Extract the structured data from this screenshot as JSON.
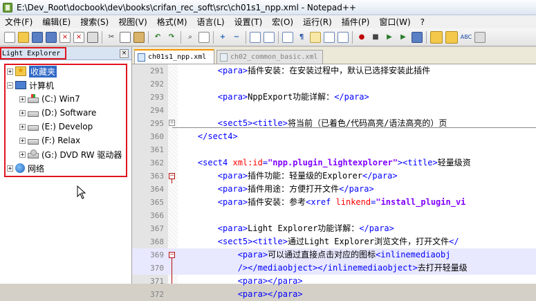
{
  "window": {
    "title": "E:\\Dev_Root\\docbook\\dev\\books\\crifan_rec_soft\\src\\ch01s1_npp.xml - Notepad++"
  },
  "menu": [
    "文件(F)",
    "编辑(E)",
    "搜索(S)",
    "视图(V)",
    "格式(M)",
    "语言(L)",
    "设置(T)",
    "宏(O)",
    "运行(R)",
    "插件(P)",
    "窗口(W)",
    "?"
  ],
  "panel": {
    "title": "Light Explorer",
    "close_label": "×",
    "tree": [
      {
        "label": "收藏夹",
        "expander": "+",
        "icon": "star-folder-icon",
        "selected": true
      },
      {
        "label": "计算机",
        "expander": "−",
        "icon": "computer-icon"
      },
      {
        "label": "(C:) Win7",
        "expander": "+",
        "icon": "system-drive-icon"
      },
      {
        "label": "(D:) Software",
        "expander": "+",
        "icon": "drive-icon"
      },
      {
        "label": "(E:) Develop",
        "expander": "+",
        "icon": "drive-icon"
      },
      {
        "label": "(F:) Relax",
        "expander": "+",
        "icon": "drive-icon"
      },
      {
        "label": "(G:) DVD RW 驱动器",
        "expander": "+",
        "icon": "dvd-drive-icon"
      },
      {
        "label": "网络",
        "expander": "+",
        "icon": "network-icon"
      }
    ]
  },
  "tabs": [
    {
      "label": "ch01s1_npp.xml",
      "active": true
    },
    {
      "label": "ch02_common_basic.xml",
      "active": false
    }
  ],
  "lines": [
    {
      "num": "291",
      "parts": [
        [
          "ind",
          "        "
        ],
        [
          "tag",
          "<para>"
        ],
        [
          "txt",
          "插件安装：在安装过程中，默认已选择安装此插件"
        ]
      ]
    },
    {
      "num": "292",
      "parts": []
    },
    {
      "num": "293",
      "parts": [
        [
          "ind",
          "        "
        ],
        [
          "tag",
          "<para>"
        ],
        [
          "txt",
          "NppExport功能详解："
        ],
        [
          "tag",
          "</para>"
        ]
      ]
    },
    {
      "num": "294",
      "parts": []
    },
    {
      "num": "295",
      "parts": [
        [
          "ind",
          "        "
        ],
        [
          "tag",
          "<sect5><title>"
        ],
        [
          "txt",
          "将当前（已着色/代码高亮/语法高亮的）页"
        ]
      ]
    },
    {
      "num": "360",
      "parts": [
        [
          "ind",
          "    "
        ],
        [
          "tag",
          "</sect4>"
        ]
      ]
    },
    {
      "num": "361",
      "parts": []
    },
    {
      "num": "362",
      "parts": [
        [
          "ind",
          "    "
        ],
        [
          "tag",
          "<sect4 "
        ],
        [
          "attr",
          "xml:id"
        ],
        [
          "tag",
          "="
        ],
        [
          "val",
          "\"npp.plugin_lightexplorer\""
        ],
        [
          "tag",
          "><title>"
        ],
        [
          "txt",
          "轻量级资"
        ]
      ]
    },
    {
      "num": "363",
      "parts": [
        [
          "ind",
          "        "
        ],
        [
          "tag",
          "<para>"
        ],
        [
          "txt",
          "插件功能：轻量级的Explorer"
        ],
        [
          "tag",
          "</para>"
        ]
      ]
    },
    {
      "num": "364",
      "parts": [
        [
          "ind",
          "        "
        ],
        [
          "tag",
          "<para>"
        ],
        [
          "txt",
          "插件用途：方便打开文件"
        ],
        [
          "tag",
          "</para>"
        ]
      ]
    },
    {
      "num": "365",
      "parts": [
        [
          "ind",
          "        "
        ],
        [
          "tag",
          "<para>"
        ],
        [
          "txt",
          "插件安装：参考"
        ],
        [
          "tag",
          "<xref "
        ],
        [
          "attr",
          "linkend"
        ],
        [
          "tag",
          "="
        ],
        [
          "val",
          "\"install_plugin_vi"
        ]
      ]
    },
    {
      "num": "366",
      "parts": []
    },
    {
      "num": "367",
      "parts": [
        [
          "ind",
          "        "
        ],
        [
          "tag",
          "<para>"
        ],
        [
          "txt",
          "Light Explorer功能详解："
        ],
        [
          "tag",
          "</para>"
        ]
      ]
    },
    {
      "num": "368",
      "parts": [
        [
          "ind",
          "        "
        ],
        [
          "tag",
          "<sect5><title>"
        ],
        [
          "txt",
          "通过Light Explorer浏览文件，打开文件"
        ],
        [
          "tag",
          "</"
        ]
      ]
    },
    {
      "num": "369",
      "parts": [
        [
          "ind",
          "            "
        ],
        [
          "tag",
          "<para>"
        ],
        [
          "txt",
          "可以通过直接点击对应的图标"
        ],
        [
          "tag",
          "<inlinemediaobj"
        ]
      ]
    },
    {
      "num": "370",
      "parts": [
        [
          "ind",
          "            "
        ],
        [
          "tag",
          "/></mediaobject></inlinemediaobject>"
        ],
        [
          "txt",
          "去打开轻量级"
        ]
      ]
    },
    {
      "num": "371",
      "parts": [
        [
          "ind",
          "            "
        ],
        [
          "tag",
          "<para></para>"
        ]
      ]
    },
    {
      "num": "372",
      "parts": [
        [
          "ind",
          "            "
        ],
        [
          "tag",
          "<para></para>"
        ]
      ]
    }
  ]
}
